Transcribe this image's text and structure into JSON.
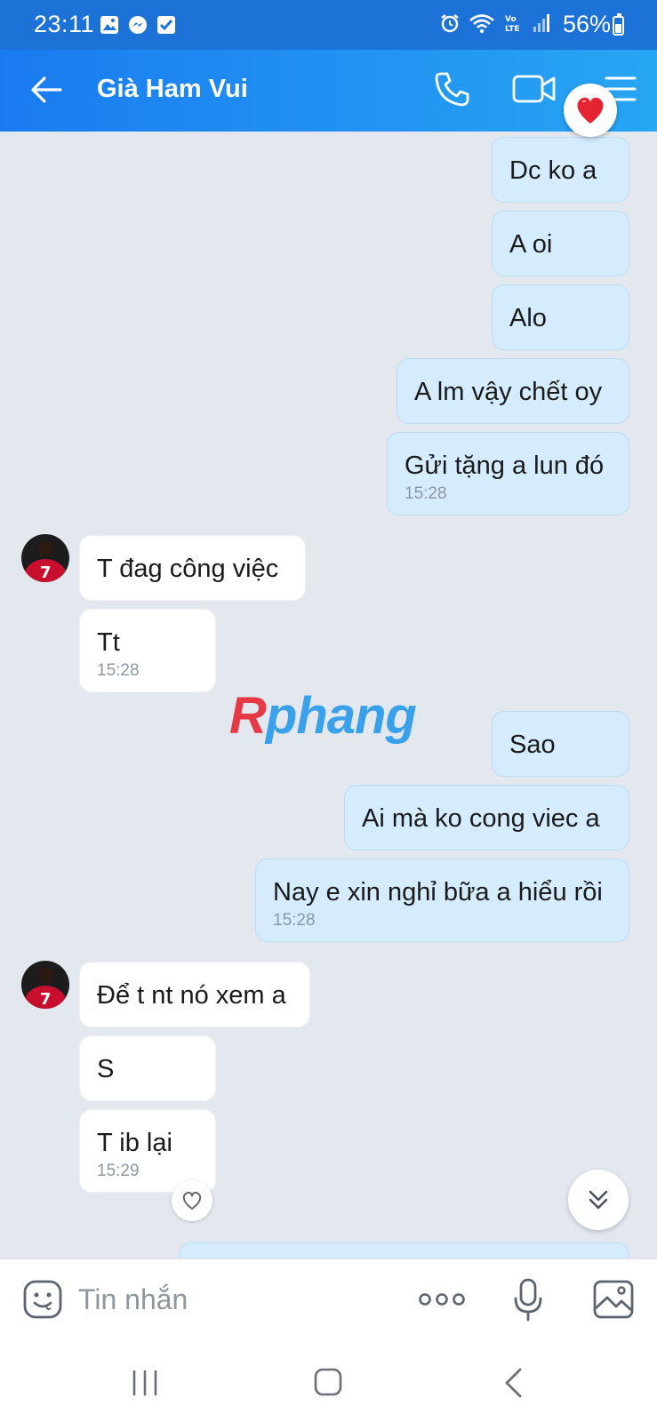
{
  "status_bar": {
    "time": "23:11",
    "battery": "56%"
  },
  "header": {
    "title": "Già Ham Vui"
  },
  "messages": [
    {
      "dir": "out",
      "text": "Dc ko a",
      "time": ""
    },
    {
      "dir": "out",
      "text": "A oi",
      "time": ""
    },
    {
      "dir": "out",
      "text": "Alo",
      "time": ""
    },
    {
      "dir": "out",
      "text": "A lm vậy chết oy",
      "time": ""
    },
    {
      "dir": "out",
      "text": "Gửi tặng a lun đó",
      "time": "15:28"
    },
    {
      "dir": "in",
      "text": "T đag công việc",
      "time": ""
    },
    {
      "dir": "in",
      "text": "Tt",
      "time": "15:28"
    },
    {
      "dir": "out",
      "text": "Sao",
      "time": ""
    },
    {
      "dir": "out",
      "text": "Ai mà ko cong viec a",
      "time": ""
    },
    {
      "dir": "out",
      "text": "Nay e xin nghỉ bữa a hiểu rồi",
      "time": "15:28"
    },
    {
      "dir": "in",
      "text": "Để t nt nó xem a",
      "time": ""
    },
    {
      "dir": "in",
      "text": "S",
      "time": ""
    },
    {
      "dir": "in",
      "text": "T ib lại",
      "time": "15:29"
    }
  ],
  "watermark": {
    "first": "R",
    "rest": "phang"
  },
  "input": {
    "placeholder": "Tin nhắn"
  },
  "colors": {
    "header_start": "#1a7bf0",
    "header_end": "#27a6f3",
    "outgoing_bubble": "#d4ecfd",
    "incoming_bubble": "#ffffff",
    "chat_background": "#e3e8ef"
  }
}
